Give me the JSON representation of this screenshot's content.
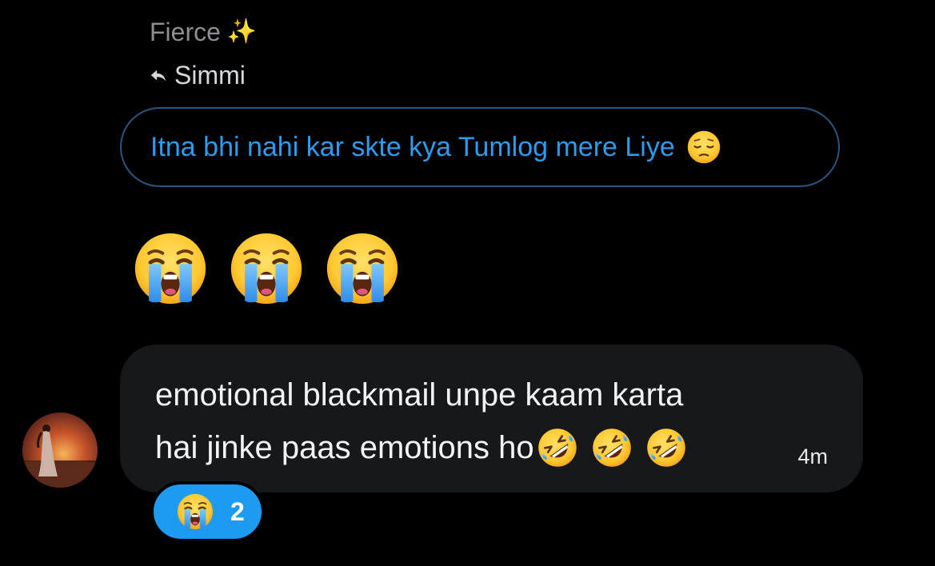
{
  "header": {
    "sender_name": "Fierce",
    "sender_badge_icon": "sparkles-icon",
    "reply_icon": "reply-arrow-icon",
    "replying_to": "Simmi"
  },
  "quoted_message": {
    "text": "Itna bhi nahi kar skte kya Tumlog mere Liye",
    "trailing_emoji": "pensive-face-icon"
  },
  "emoji_message": {
    "emojis": [
      "loudly-crying-face-icon",
      "loudly-crying-face-icon",
      "loudly-crying-face-icon"
    ]
  },
  "message": {
    "line1": "emotional blackmail unpe kaam karta",
    "line2": "hai jinke paas emotions ho",
    "trailing_emojis": [
      "rolling-on-floor-laughing-icon",
      "rolling-on-floor-laughing-icon",
      "rolling-on-floor-laughing-icon"
    ],
    "timestamp": "4m"
  },
  "reaction": {
    "emoji": "loudly-crying-face-icon",
    "count": "2"
  },
  "colors": {
    "background": "#000000",
    "accent_blue": "#1d9bf0",
    "quoted_border": "#2a5580",
    "bubble": "#16181c",
    "muted_text": "#8b8f94"
  }
}
